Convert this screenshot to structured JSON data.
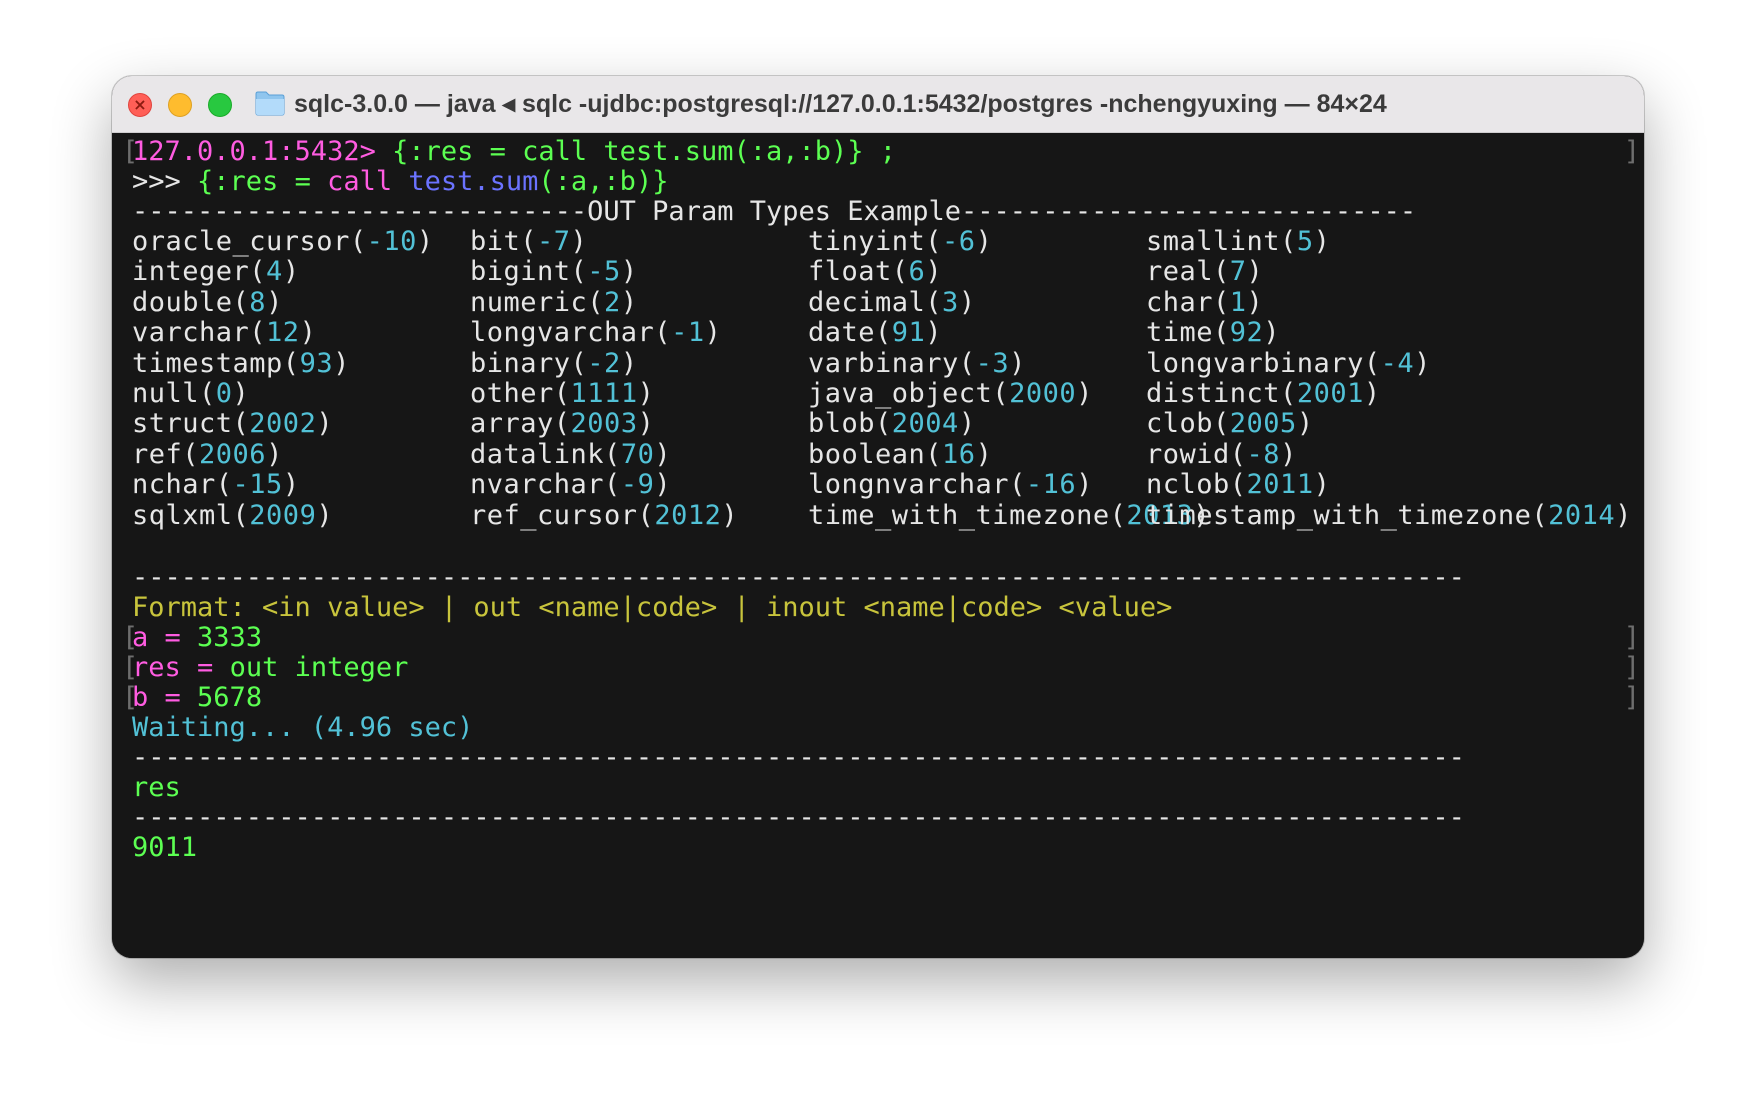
{
  "window": {
    "title": "sqlc-3.0.0 — java ◂ sqlc -ujdbc:postgresql://127.0.0.1:5432/postgres -nchengyuxing — 84×24"
  },
  "terminal": {
    "prompt": "127.0.0.1:5432>",
    "command_input": "{:res = call test.sum(:a,:b)} ;",
    "echo_prefix": ">>> ",
    "echo_open": "{:res = ",
    "echo_call": "call ",
    "echo_fn": "test.sum",
    "echo_args": "(:a,:b)}",
    "header_title": "OUT Param Types Example",
    "types": [
      {
        "name": "oracle_cursor",
        "code": "-10"
      },
      {
        "name": "bit",
        "code": "-7"
      },
      {
        "name": "tinyint",
        "code": "-6"
      },
      {
        "name": "smallint",
        "code": "5"
      },
      {
        "name": "integer",
        "code": "4"
      },
      {
        "name": "bigint",
        "code": "-5"
      },
      {
        "name": "float",
        "code": "6"
      },
      {
        "name": "real",
        "code": "7"
      },
      {
        "name": "double",
        "code": "8"
      },
      {
        "name": "numeric",
        "code": "2"
      },
      {
        "name": "decimal",
        "code": "3"
      },
      {
        "name": "char",
        "code": "1"
      },
      {
        "name": "varchar",
        "code": "12"
      },
      {
        "name": "longvarchar",
        "code": "-1"
      },
      {
        "name": "date",
        "code": "91"
      },
      {
        "name": "time",
        "code": "92"
      },
      {
        "name": "timestamp",
        "code": "93"
      },
      {
        "name": "binary",
        "code": "-2"
      },
      {
        "name": "varbinary",
        "code": "-3"
      },
      {
        "name": "longvarbinary",
        "code": "-4"
      },
      {
        "name": "null",
        "code": "0"
      },
      {
        "name": "other",
        "code": "1111"
      },
      {
        "name": "java_object",
        "code": "2000"
      },
      {
        "name": "distinct",
        "code": "2001"
      },
      {
        "name": "struct",
        "code": "2002"
      },
      {
        "name": "array",
        "code": "2003"
      },
      {
        "name": "blob",
        "code": "2004"
      },
      {
        "name": "clob",
        "code": "2005"
      },
      {
        "name": "ref",
        "code": "2006"
      },
      {
        "name": "datalink",
        "code": "70"
      },
      {
        "name": "boolean",
        "code": "16"
      },
      {
        "name": "rowid",
        "code": "-8"
      },
      {
        "name": "nchar",
        "code": "-15"
      },
      {
        "name": "nvarchar",
        "code": "-9"
      },
      {
        "name": "longnvarchar",
        "code": "-16"
      },
      {
        "name": "nclob",
        "code": "2011"
      },
      {
        "name": "sqlxml",
        "code": "2009"
      },
      {
        "name": "ref_cursor",
        "code": "2012"
      },
      {
        "name": "time_with_timezone",
        "code": "2013"
      },
      {
        "name": "timestamp_with_timezone",
        "code": "2014"
      }
    ],
    "format_hint": "Format: <in value> | out <name|code> | inout <name|code> <value>",
    "param_inputs": [
      {
        "name": "a",
        "eq": " = ",
        "value": "3333"
      },
      {
        "name": "res",
        "eq": " = ",
        "value": "out integer"
      },
      {
        "name": "b",
        "eq": " = ",
        "value": "5678"
      }
    ],
    "waiting": "Waiting... (4.96 sec)",
    "result_header": "res",
    "result_value": "9011"
  },
  "colors": {
    "prompt": "#ff5ce1",
    "command": "#5cff52",
    "function": "#6b73ff",
    "code": "#52c1d6",
    "hint": "#c8c43c",
    "background": "#161616"
  }
}
